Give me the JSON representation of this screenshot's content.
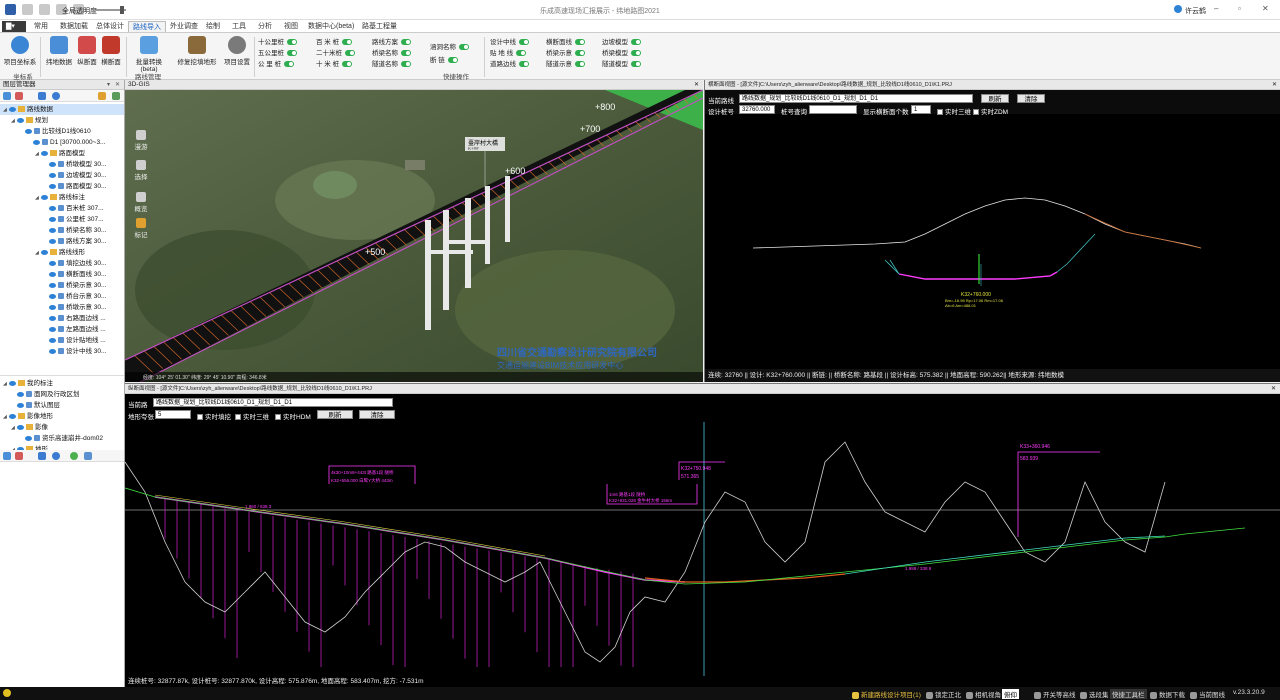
{
  "window": {
    "title": "乐成高速现场汇报展示 - 纬地路图2021",
    "quick_label": "全局透明度",
    "user": "许云鹤"
  },
  "menu": {
    "file": "",
    "tabs": [
      "常用",
      "数据加载",
      "总体设计",
      "路线导入",
      "外业调查",
      "绘制",
      "工具",
      "分析",
      "视图",
      "数据中心(beta)",
      "路基工程量"
    ],
    "active": "路线导入"
  },
  "ribbon": {
    "buttons": [
      {
        "label": "项目坐标系"
      },
      {
        "label": "纬地数据"
      },
      {
        "label": "纵断面"
      },
      {
        "label": "横断面"
      },
      {
        "label": "批量转换(beta)"
      },
      {
        "label": "修复挖填地形"
      },
      {
        "label": "项目设置"
      }
    ],
    "groups": [
      "坐标系",
      "路线管理",
      "快捷操作"
    ],
    "toggles": {
      "col1": [
        "十公里桩",
        "五公里桩",
        "公 里 桩"
      ],
      "col2": [
        "百 米 桩",
        "二十米桩",
        "十 米 桩"
      ],
      "col3": [
        "路线方案",
        "桥梁名称",
        "隧道名称"
      ],
      "col4": [
        "涵洞名称",
        "断 链"
      ],
      "col5": [
        "设计中线",
        "贴 地 线",
        "道路边线"
      ],
      "col6": [
        "横断面线",
        "桥梁示意",
        "隧道示意"
      ],
      "col7": [
        "边坡模型",
        "桥梁模型",
        "隧道模型"
      ]
    }
  },
  "layer_manager": {
    "title": "图层管理器",
    "tree": [
      {
        "label": "路线数据",
        "level": 0,
        "icon": "folder",
        "selected": true
      },
      {
        "label": "规划",
        "level": 1,
        "icon": "folder"
      },
      {
        "label": "比较线D1线0610",
        "level": 2,
        "icon": "layer"
      },
      {
        "label": "D1 [30700.000~3...",
        "level": 3,
        "icon": "layer"
      },
      {
        "label": "路面模型",
        "level": 4,
        "icon": "folder"
      },
      {
        "label": "桥墩模型 30...",
        "level": 5,
        "icon": "layer"
      },
      {
        "label": "边坡模型 30...",
        "level": 5,
        "icon": "layer"
      },
      {
        "label": "路面模型 30...",
        "level": 5,
        "icon": "layer"
      },
      {
        "label": "路线标注",
        "level": 4,
        "icon": "folder"
      },
      {
        "label": "百米桩 307...",
        "level": 5,
        "icon": "layer"
      },
      {
        "label": "公里桩 307...",
        "level": 5,
        "icon": "layer"
      },
      {
        "label": "桥梁名称 30...",
        "level": 5,
        "icon": "layer"
      },
      {
        "label": "路线方案 30...",
        "level": 5,
        "icon": "layer"
      },
      {
        "label": "路线线形",
        "level": 4,
        "icon": "folder"
      },
      {
        "label": "填挖边线 30...",
        "level": 5,
        "icon": "layer"
      },
      {
        "label": "横断面线 30...",
        "level": 5,
        "icon": "layer"
      },
      {
        "label": "桥梁示意 30...",
        "level": 5,
        "icon": "layer"
      },
      {
        "label": "桥台示意 30...",
        "level": 5,
        "icon": "layer"
      },
      {
        "label": "桥墩示意 30...",
        "level": 5,
        "icon": "layer"
      },
      {
        "label": "右路面边线 ...",
        "level": 5,
        "icon": "layer"
      },
      {
        "label": "左路面边线 ...",
        "level": 5,
        "icon": "layer"
      },
      {
        "label": "设计贴地线 ...",
        "level": 5,
        "icon": "layer"
      },
      {
        "label": "设计中线 30...",
        "level": 5,
        "icon": "layer"
      }
    ],
    "tree2": [
      {
        "label": "我的标注",
        "level": 0,
        "icon": "folder"
      },
      {
        "label": "面网及行政区划",
        "level": 1,
        "icon": "layer"
      },
      {
        "label": "默认图层",
        "level": 1,
        "icon": "layer"
      },
      {
        "label": "影像地形",
        "level": 0,
        "icon": "folder"
      },
      {
        "label": "影像",
        "level": 1,
        "icon": "folder"
      },
      {
        "label": "资乐高速崩井-dom02",
        "level": 2,
        "icon": "layer"
      },
      {
        "label": "地形",
        "level": 1,
        "icon": "folder"
      }
    ]
  },
  "gis": {
    "title": "3D-GIS",
    "side_buttons": [
      "漫游",
      "选择",
      "概览",
      "标记"
    ],
    "labels": [
      "+800",
      "+700",
      "+600",
      "+500"
    ],
    "callout": "臺岸村大橋",
    "callout_sub": "K+##",
    "watermark1": "四川省交通勘察设计研究院有限公司",
    "watermark2": "交通运输建设BIM技术应用研发中心",
    "coords": "经度: 104° 25' 01.30\"  纬度: 29° 45' 10.90\"  高程: 346.8米"
  },
  "cross": {
    "title": "横断面视图 - [源文件]C:\\Users\\zyh_alienware\\Desktop\\路线数据_规划_比较线D1线0610_D1\\K1.PRJ",
    "route_label": "当前路线",
    "route_value": "路线数据_规划_比较线D1线0610_D1_规划_D1_D1",
    "refresh": "刷新",
    "clear": "清除",
    "station_label": "设计桩号",
    "station_value": "32760.000",
    "query_label": "桩号查询",
    "count_label": "显示横断面个数",
    "count_value": "1",
    "realtime_3d": "实时三维",
    "realtime_zdm": "实时ZDM",
    "center_label": "K32+760.000",
    "center_sub1": "Bm=-16.98 Rp=17.06 Rm=17.06",
    "center_sub2": "Ab=6 Am=488.01",
    "status": "连续: 32760 || 设计: K32+760.000 || 断链:    || 桥断名称: 路基段 || 设计标高: 575.382 || 地面高程: 590.262|| 地形来源: 纬地数模"
  },
  "profile": {
    "title": "纵断面视图 - [源文件]C:\\Users\\zyh_alienware\\Desktop\\路线数据_规划_比较线D1线0610_D1\\K1.PRJ",
    "route_label": "当前路",
    "route_value": "路线数据_规划_比较线D1线0610_D1_规划_D1_D1",
    "scale_label": "地形夸张",
    "scale_value": "5",
    "cb1": "实时填挖",
    "cb2": "实时三维",
    "cb3": "实时HDM",
    "refresh": "刷新",
    "clear": "清除",
    "ann1a": "K32+556.000 白鹭Y大桥 443m",
    "ann1b": "4k30+10m8+443t 路基1段 隧桥",
    "ann2a": "K32+750.948",
    "ann2b": "571.365",
    "ann3a": "K33+360.946",
    "ann3b": "583.939",
    "ann4a": "K32+931.028 金牛村大桥 156m",
    "ann4b": "1m6 路基1段 隧桥",
    "grade1": "1.960 / 638.3",
    "grade2": "1.988 / 338.9",
    "status": "连续桩号: 32877.87k, 设计桩号: 32877.870k, 设计高程: 575.876m, 地面高程: 583.407m, 挖方: -7.531m"
  },
  "statusbar": {
    "items": [
      "新建路线设计项目(1)",
      "锁定正北",
      "相机视角",
      "俯仰",
      "开关等高线",
      "选段集",
      "快捷工具栏",
      "数据下载",
      "当前图线"
    ],
    "version": "v.23.3.20.9"
  }
}
